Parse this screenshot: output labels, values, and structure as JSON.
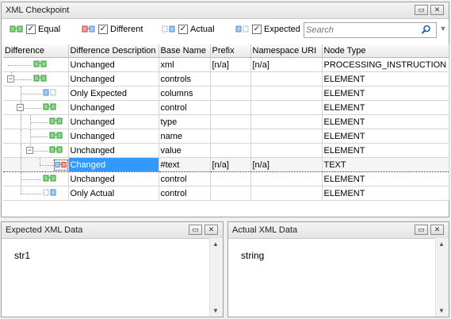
{
  "checkpoint": {
    "title": "XML Checkpoint",
    "filters": {
      "equal": "Equal",
      "different": "Different",
      "actual": "Actual",
      "expected": "Expected"
    },
    "search_placeholder": "Search"
  },
  "table": {
    "columns": [
      "Difference",
      "Difference Description",
      "Base Name",
      "Prefix",
      "Namespace URI",
      "Node Type"
    ],
    "rows": [
      {
        "desc": "Unchanged",
        "base": "xml",
        "prefix": "[n/a]",
        "ns": "[n/a]",
        "type": "PROCESSING_INSTRUCTION"
      },
      {
        "desc": "Unchanged",
        "base": "controls",
        "prefix": "",
        "ns": "",
        "type": "ELEMENT"
      },
      {
        "desc": "Only Expected",
        "base": "columns",
        "prefix": "",
        "ns": "",
        "type": "ELEMENT"
      },
      {
        "desc": "Unchanged",
        "base": "control",
        "prefix": "",
        "ns": "",
        "type": "ELEMENT"
      },
      {
        "desc": "Unchanged",
        "base": "type",
        "prefix": "",
        "ns": "",
        "type": "ELEMENT"
      },
      {
        "desc": "Unchanged",
        "base": "name",
        "prefix": "",
        "ns": "",
        "type": "ELEMENT"
      },
      {
        "desc": "Unchanged",
        "base": "value",
        "prefix": "",
        "ns": "",
        "type": "ELEMENT"
      },
      {
        "desc": "Changed",
        "base": "#text",
        "prefix": "[n/a]",
        "ns": "[n/a]",
        "type": "TEXT"
      },
      {
        "desc": "Unchanged",
        "base": "control",
        "prefix": "",
        "ns": "",
        "type": "ELEMENT"
      },
      {
        "desc": "Only Actual",
        "base": "control",
        "prefix": "",
        "ns": "",
        "type": "ELEMENT"
      }
    ]
  },
  "expected_panel": {
    "title": "Expected XML Data",
    "content": "str1"
  },
  "actual_panel": {
    "title": "Actual XML Data",
    "content": "string"
  },
  "colors": {
    "equal": "#2e9e2e",
    "different": "#d93030",
    "actual_expected": "#4a90d9",
    "selection": "#3399ff"
  }
}
